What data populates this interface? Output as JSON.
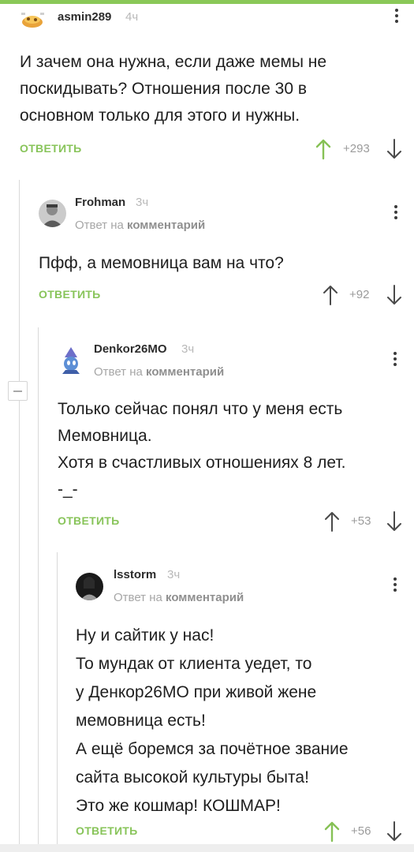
{
  "comments": [
    {
      "user": "asmin289",
      "time": "4ч",
      "body": [
        "И зачем она нужна, если даже мемы не",
        "поскидывать? Отношения после 30 в",
        "основном только для этого и нужны."
      ],
      "reply_label": "ОТВЕТИТЬ",
      "score": "+293",
      "upvoted": true
    },
    {
      "user": "Frohman",
      "time": "3ч",
      "reply_note_prefix": "Ответ на",
      "reply_note_link": "комментарий",
      "body": [
        "Пфф, а мемовница вам на что?"
      ],
      "reply_label": "ОТВЕТИТЬ",
      "score": "+92",
      "upvoted": false
    },
    {
      "user": "Denkor26MO",
      "time": "3ч",
      "reply_note_prefix": "Ответ на",
      "reply_note_link": "комментарий",
      "body": [
        "Только сейчас понял что у меня есть",
        "Мемовница.",
        "Хотя в счастливых отношениях 8 лет.",
        "-_-"
      ],
      "reply_label": "ОТВЕТИТЬ",
      "score": "+53",
      "upvoted": false
    },
    {
      "user": "lsstorm",
      "time": "3ч",
      "reply_note_prefix": "Ответ на",
      "reply_note_link": "комментарий",
      "body": [
        "Ну и сайтик у нас!",
        "То мундак от клиента уедет, то",
        "у Денкор26МО при живой жене",
        "мемовница есть!",
        "А ещё боремся за почётное звание",
        "сайта высокой культуры быта!",
        "Это же кошмар! КОШМАР!"
      ],
      "reply_label": "ОТВЕТИТЬ",
      "score": "+56",
      "upvoted": true
    }
  ],
  "colors": {
    "accent": "#88c45a",
    "meta": "#b8b8b8",
    "text": "#1e1e1e"
  },
  "icons": [
    "collapse-icon",
    "more-vertical-icon",
    "arrow-up-icon",
    "arrow-down-icon"
  ]
}
